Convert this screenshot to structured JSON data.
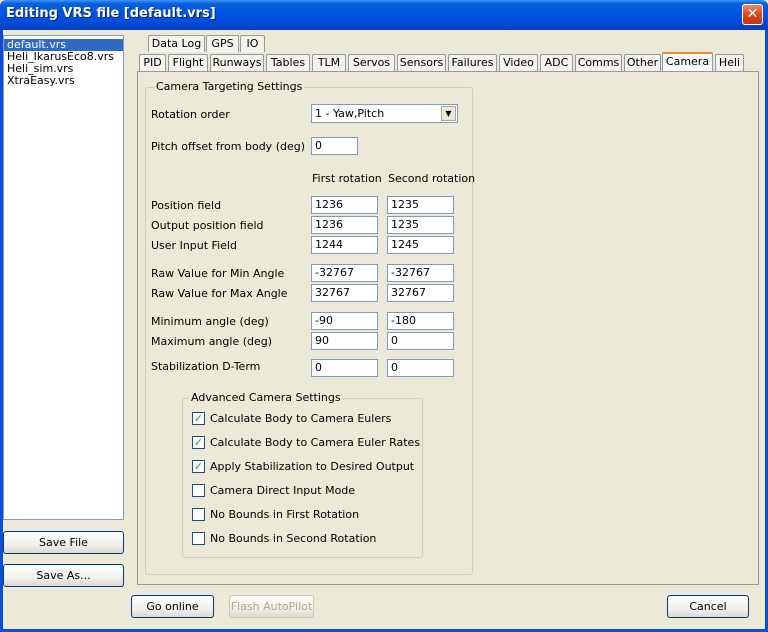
{
  "window": {
    "title": "Editing VRS file [default.vrs]",
    "close_glyph": "✕"
  },
  "files": [
    "default.vrs",
    "Heli_IkarusEco8.vrs",
    "Heli_sim.vrs",
    "XtraEasy.vrs"
  ],
  "selected_file": "default.vrs",
  "buttons": {
    "save_file": "Save File",
    "save_as": "Save As...",
    "go_online": "Go online",
    "flash_autopilot": "Flash AutoPilot",
    "cancel": "Cancel"
  },
  "tabs_row1": [
    "Data Log",
    "GPS",
    "IO"
  ],
  "tabs_row2": [
    "PID",
    "Flight",
    "Runways",
    "Tables",
    "TLM",
    "Servos",
    "Sensors",
    "Failures",
    "Video",
    "ADC",
    "Comms",
    "Other",
    "Camera",
    "Heli"
  ],
  "active_tab": "Camera",
  "camera": {
    "group_title": "Camera Targeting Settings",
    "rotation_order_label": "Rotation order",
    "rotation_order_value": "1 - Yaw,Pitch",
    "pitch_offset_label": "Pitch offset from body (deg)",
    "pitch_offset_value": "0",
    "col_first": "First rotation",
    "col_second": "Second rotation",
    "rows": [
      {
        "label": "Position field",
        "first": "1236",
        "second": "1235"
      },
      {
        "label": "Output position field",
        "first": "1236",
        "second": "1235"
      },
      {
        "label": "User Input Field",
        "first": "1244",
        "second": "1245"
      },
      {
        "label": "Raw Value for Min Angle",
        "first": "-32767",
        "second": "-32767"
      },
      {
        "label": "Raw Value for Max Angle",
        "first": "32767",
        "second": "32767"
      },
      {
        "label": "Minimum angle (deg)",
        "first": "-90",
        "second": "-180"
      },
      {
        "label": "Maximum angle (deg)",
        "first": "90",
        "second": "0"
      },
      {
        "label": "Stabilization D-Term",
        "first": "0",
        "second": "0"
      }
    ],
    "advanced_title": "Advanced Camera Settings",
    "checkboxes": [
      {
        "label": "Calculate Body to Camera Eulers",
        "checked": true
      },
      {
        "label": "Calculate Body to Camera Euler Rates",
        "checked": true
      },
      {
        "label": "Apply Stabilization to Desired Output",
        "checked": true
      },
      {
        "label": "Camera Direct Input Mode",
        "checked": false
      },
      {
        "label": "No Bounds in First Rotation",
        "checked": false
      },
      {
        "label": "No Bounds in Second Rotation",
        "checked": false
      }
    ],
    "check_glyph": "✓"
  }
}
